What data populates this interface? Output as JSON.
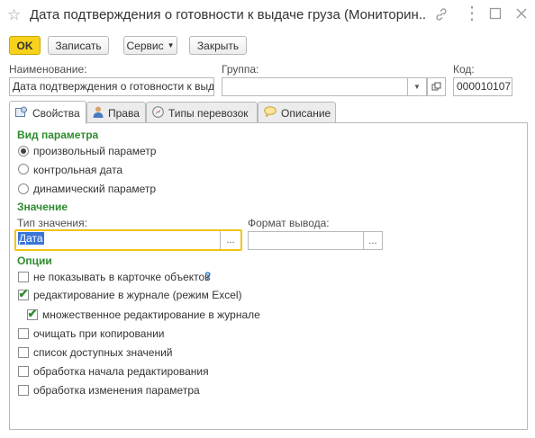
{
  "window": {
    "title": "Дата подтверждения о готовности к выдаче груза (Мониторин..."
  },
  "toolbar": {
    "ok_label": "OK",
    "write_label": "Записать",
    "service_label": "Сервис",
    "close_label": "Закрыть"
  },
  "form": {
    "name_label": "Наименование:",
    "name_value": "Дата подтверждения о готовности к выдач",
    "group_label": "Группа:",
    "group_value": "",
    "code_label": "Код:",
    "code_value": "000010107"
  },
  "tabs": [
    {
      "label": "Свойства",
      "icon": "properties-icon",
      "active": true
    },
    {
      "label": "Права",
      "icon": "user-icon",
      "active": false
    },
    {
      "label": "Типы перевозок",
      "icon": "compass-icon",
      "active": false
    },
    {
      "label": "Описание",
      "icon": "speech-bubble-icon",
      "active": false
    }
  ],
  "param_kind": {
    "heading": "Вид параметра",
    "options": [
      {
        "label": "произвольный параметр",
        "selected": true
      },
      {
        "label": "контрольная дата",
        "selected": false
      },
      {
        "label": "динамический параметр",
        "selected": false
      }
    ]
  },
  "value": {
    "heading": "Значение",
    "type_label": "Тип значения:",
    "type_value": "Дата",
    "format_label": "Формат вывода:",
    "format_value": "",
    "select_button": "..."
  },
  "options": {
    "heading": "Опции",
    "help_symbol": "?",
    "items": [
      {
        "label": "не показывать в карточке объектов",
        "checked": false
      },
      {
        "label": "редактирование в журнале (режим Excel)",
        "checked": true
      },
      {
        "label": "множественное редактирование в журнале",
        "checked": true
      },
      {
        "label": "очищать при копировании",
        "checked": false
      },
      {
        "label": "список доступных значений",
        "checked": false
      },
      {
        "label": "обработка начала  редактирования",
        "checked": false
      },
      {
        "label": "обработка изменения  параметра",
        "checked": false
      }
    ]
  },
  "colors": {
    "accent_ok": "#f7d11a",
    "section_green": "#2e8b2e",
    "focus_border": "#f0c419",
    "help_blue": "#2a7bd4"
  }
}
